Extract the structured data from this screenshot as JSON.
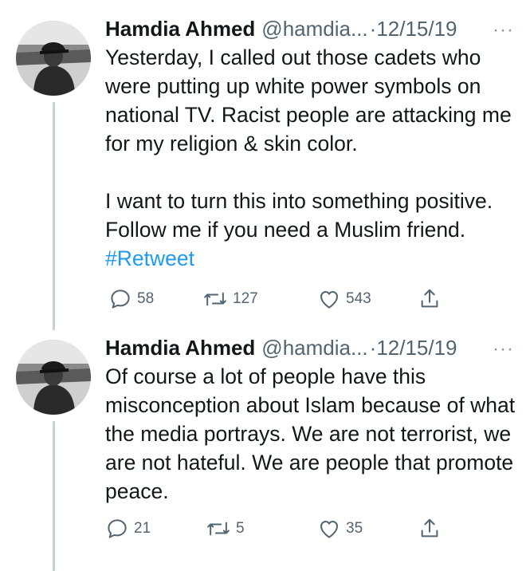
{
  "tweets": [
    {
      "author_name": "Hamdia Ahmed",
      "handle": "@hamdia...",
      "separator": "·",
      "date": "12/15/19",
      "more": "···",
      "paragraphs": [
        "Yesterday, I called out those cadets who were putting up white power symbols on national TV.  Racist people are attacking me for my religion & skin color.",
        "I want to turn this into something positive. Follow me if you need a Muslim friend."
      ],
      "hashtag": "#Retweet",
      "replies": "58",
      "retweets": "127",
      "likes": "543"
    },
    {
      "author_name": "Hamdia Ahmed",
      "handle": "@hamdia...",
      "separator": "·",
      "date": "12/15/19",
      "more": "···",
      "paragraphs": [
        "Of course a lot of people have this misconception about Islam because of what the media portrays. We are not terrorist, we are not hateful. We are people that promote peace."
      ],
      "replies": "21",
      "retweets": "5",
      "likes": "35"
    }
  ],
  "icons": {
    "reply": "reply-icon",
    "retweet": "retweet-icon",
    "like": "like-icon",
    "share": "share-icon"
  },
  "colors": {
    "text": "#14171a",
    "muted": "#536471",
    "link": "#1d9bf0",
    "thread_line": "#c4cfd6"
  }
}
